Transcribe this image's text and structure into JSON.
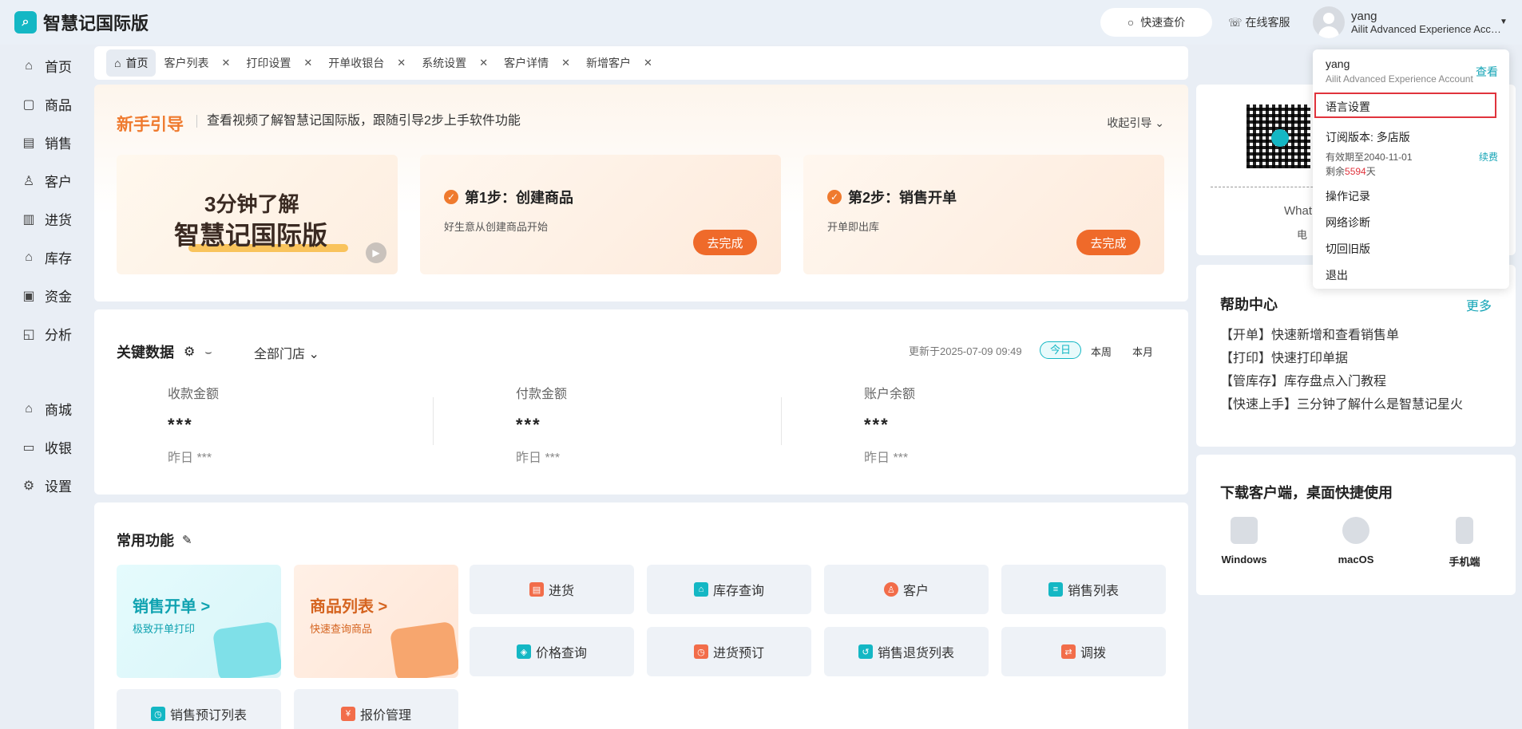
{
  "app": {
    "title": "智慧记国际版"
  },
  "header": {
    "quick_price": "快速查价",
    "online_service": "在线客服",
    "user_name": "yang",
    "user_account": "Ailit Advanced Experience Account"
  },
  "sidebar": {
    "items": [
      {
        "label": "首页",
        "icon": "home-icon"
      },
      {
        "label": "商品",
        "icon": "goods-icon"
      },
      {
        "label": "销售",
        "icon": "sales-icon"
      },
      {
        "label": "客户",
        "icon": "customer-icon"
      },
      {
        "label": "进货",
        "icon": "purchase-icon"
      },
      {
        "label": "库存",
        "icon": "inventory-icon"
      },
      {
        "label": "资金",
        "icon": "funds-icon"
      },
      {
        "label": "分析",
        "icon": "analysis-icon"
      },
      {
        "label": "商城",
        "icon": "mall-icon"
      },
      {
        "label": "收银",
        "icon": "cashier-icon"
      },
      {
        "label": "设置",
        "icon": "settings-icon"
      }
    ]
  },
  "tabs": [
    {
      "label": "首页",
      "active": true
    },
    {
      "label": "客户列表"
    },
    {
      "label": "打印设置"
    },
    {
      "label": "开单收银台"
    },
    {
      "label": "系统设置"
    },
    {
      "label": "客户详情"
    },
    {
      "label": "新增客户"
    }
  ],
  "guide": {
    "title": "新手引导",
    "subtitle": "查看视频了解智慧记国际版，跟随引导2步上手软件功能",
    "collapse": "收起引导",
    "video_line1": "3分钟了解",
    "video_line2": "智慧记国际版",
    "step1": {
      "title": "第1步：创建商品",
      "desc": "好生意从创建商品开始",
      "button": "去完成"
    },
    "step2": {
      "title": "第2步：销售开单",
      "desc": "开单即出库",
      "button": "去完成"
    }
  },
  "key_data": {
    "title": "关键数据",
    "store": "全部门店",
    "updated": "更新于2025-07-09 09:49",
    "periods": [
      "今日",
      "本周",
      "本月"
    ],
    "kpis": [
      {
        "label": "收款金额",
        "value": "***",
        "yesterday": "昨日 ***"
      },
      {
        "label": "付款金额",
        "value": "***",
        "yesterday": "昨日 ***"
      },
      {
        "label": "账户余额",
        "value": "***",
        "yesterday": "昨日 ***"
      }
    ]
  },
  "functions": {
    "title": "常用功能",
    "big": [
      {
        "title": "销售开单 >",
        "desc": "极致开单打印"
      },
      {
        "title": "商品列表 >",
        "desc": "快速查询商品"
      }
    ],
    "small": [
      {
        "label": "进货",
        "color": "#f26d4a"
      },
      {
        "label": "库存查询",
        "color": "#14b7c4"
      },
      {
        "label": "客户",
        "color": "#f26d4a"
      },
      {
        "label": "销售列表",
        "color": "#14b7c4"
      },
      {
        "label": "价格查询",
        "color": "#14b7c4"
      },
      {
        "label": "进货预订",
        "color": "#f26d4a"
      },
      {
        "label": "销售退货列表",
        "color": "#14b7c4"
      },
      {
        "label": "调拨",
        "color": "#f26d4a"
      },
      {
        "label": "销售预订列表",
        "color": "#14b7c4"
      },
      {
        "label": "报价管理",
        "color": "#f26d4a"
      }
    ]
  },
  "qr": {
    "text1": "What",
    "text2": "电"
  },
  "help": {
    "title": "帮助中心",
    "more": "更多",
    "items": [
      "【开单】快速新增和查看销售单",
      "【打印】快速打印单据",
      "【管库存】库存盘点入门教程",
      "【快速上手】三分钟了解什么是智慧记星火"
    ]
  },
  "download": {
    "title": "下载客户端，桌面快捷使用",
    "items": [
      "Windows",
      "macOS",
      "手机端"
    ]
  },
  "dropdown": {
    "name": "yang",
    "account": "Ailit Advanced Experience Account",
    "view": "查看",
    "language": "语言设置",
    "plan": "订阅版本: 多店版",
    "expiry": "有效期至2040-11-01",
    "remain_prefix": "剩余",
    "remain_days": "5594",
    "remain_suffix": "天",
    "renew": "续费",
    "items": [
      "操作记录",
      "网络诊断",
      "切回旧版",
      "退出"
    ]
  },
  "colors": {
    "accent": "#14b7c4",
    "orange": "#ef7a2e",
    "highlight": "#e0333c"
  }
}
